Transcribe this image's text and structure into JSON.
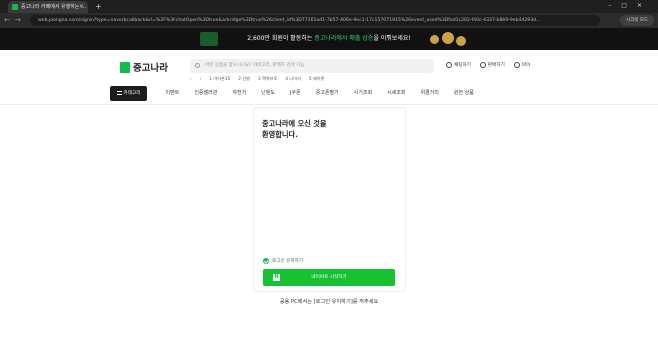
{
  "browser": {
    "tab_title": "중고나라 카페에서 유행하는 …",
    "url": "web.joongna.com/signin?type=naverbcallback&rl=%2F%3FchatOpen%3Dtrue&arbridge%3Dtrue%26client_id%3D77161ad1-7b57-406e-9ec1-17c157071915%26event_used%3Dfad1c202-f40c-4337-b8b9-9eb44293d…",
    "profile_label": "시크릿 모드"
  },
  "banner": {
    "text_prefix": "2,600만 회원이 활동하는 ",
    "highlight": "중고나라에서 매출 상승",
    "text_suffix": "을 이뤄보세요!"
  },
  "header": {
    "logo_text": "중고나라",
    "search_placeholder": "어떤 상품을 찾으시나요? 카테고리, 판매자 검색 가능",
    "links": [
      {
        "label": "채팅하기",
        "icon": "chat-icon"
      },
      {
        "label": "판매하기",
        "icon": "sell-icon"
      },
      {
        "label": "마이",
        "icon": "user-icon"
      }
    ],
    "popular": [
      "1 아이폰15",
      "2 신발",
      "3 맥북프로",
      "4 나이키",
      "5 에어팟"
    ]
  },
  "nav": {
    "category_label": "카테고리",
    "items": [
      "이벤트",
      "인증셀러관",
      "자전거",
      "닌텐도",
      "J쿠폰",
      "중고폰팔기",
      "사기조회",
      "시세조회",
      "위클거리",
      "원한 상품"
    ]
  },
  "login": {
    "welcome_line1": "중고나라에 오신 것을",
    "welcome_line2": "환영합니다.",
    "keep_logged_in": "로그인 유지하기",
    "naver_button": "네이버로 시작하기",
    "naver_badge": "N"
  },
  "notice": "공용 PC에서는 [로그인 유지하기]를 꺼주세요",
  "colors": {
    "brand_green": "#0cc04a",
    "naver_green": "#16c132",
    "banner_bg": "#111111"
  }
}
